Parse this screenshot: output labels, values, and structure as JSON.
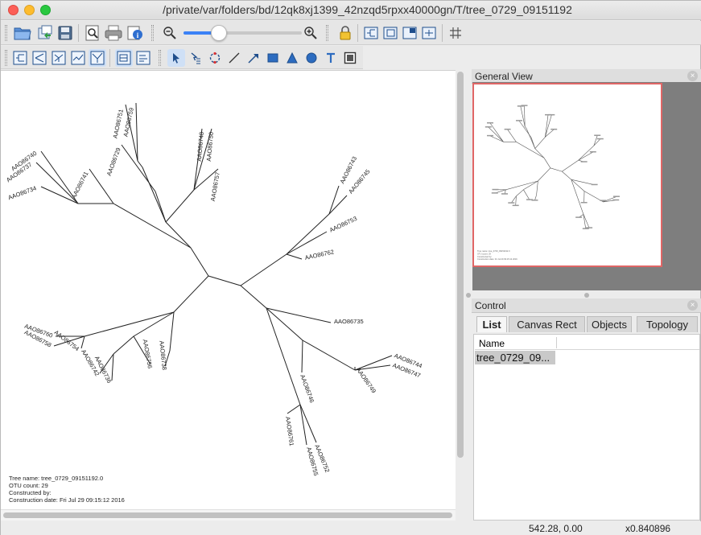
{
  "window": {
    "title": "/private/var/folders/bd/12qk8xj1399_42nzqd5rpxx40000gn/T/tree_0729_09151192"
  },
  "toolbar": {
    "icons": [
      "open-folder-icon",
      "export-icon",
      "save-icon",
      "find-icon",
      "print-icon",
      "info-icon",
      "zoom-out-icon",
      "zoom-in-icon",
      "lock-icon",
      "tree-view-1-icon",
      "tree-view-2-icon",
      "tree-view-3-icon",
      "tree-view-4-icon",
      "grid-icon"
    ],
    "zoom_slider_value": 0.3
  },
  "toolbar2": {
    "layout_icons": [
      "rectangular-tree-icon",
      "slanted-tree-icon",
      "circular-tree-icon",
      "radial-tree-icon",
      "unrooted-tree-icon",
      "layout-a-icon",
      "layout-b-icon"
    ],
    "draw_tools": [
      "select-arrow-icon",
      "hand-select-icon",
      "rotate-icon",
      "line-tool-icon",
      "arrow-tool-icon",
      "rectangle-tool-icon",
      "triangle-tool-icon",
      "circle-tool-icon",
      "text-tool-icon",
      "frame-tool-icon"
    ]
  },
  "tree": {
    "leaves": [
      "AAO86751",
      "AAO86759",
      "AAO86729",
      "AAO86748",
      "AAO86750",
      "AAO86757",
      "AAO86741",
      "AAO86740",
      "AAO86737",
      "AAO86734",
      "AAO86743",
      "AAO86745",
      "AAO86753",
      "AAO86762",
      "AAO86735",
      "AAO86744",
      "AAO86747",
      "AAO86749",
      "AAO86746",
      "AAO86752",
      "AAO86755",
      "AAO86761",
      "AAO86760",
      "AAO86758",
      "AAO86754",
      "AAO86742",
      "AAO86736",
      "AAO86756",
      "AAO86738"
    ],
    "info": {
      "name_line": "Tree name: tree_0729_09151192.0",
      "otu_line": "OTU count: 29",
      "constructed_by_line": "Constructed by:",
      "date_line": "Construction date: Fri Jul 29 09:15:12 2016"
    }
  },
  "general_view": {
    "title": "General View"
  },
  "control": {
    "title": "Control",
    "tabs": [
      "List",
      "Canvas Rect",
      "Objects",
      "Topology"
    ],
    "active_tab": "List",
    "list_header": "Name",
    "rows": [
      "tree_0729_09..."
    ]
  },
  "status": {
    "coords": "542.28, 0.00",
    "zoom": "x0.840896"
  },
  "colors": {
    "accent": "#3b82f6",
    "frame_highlight": "#e06666"
  }
}
